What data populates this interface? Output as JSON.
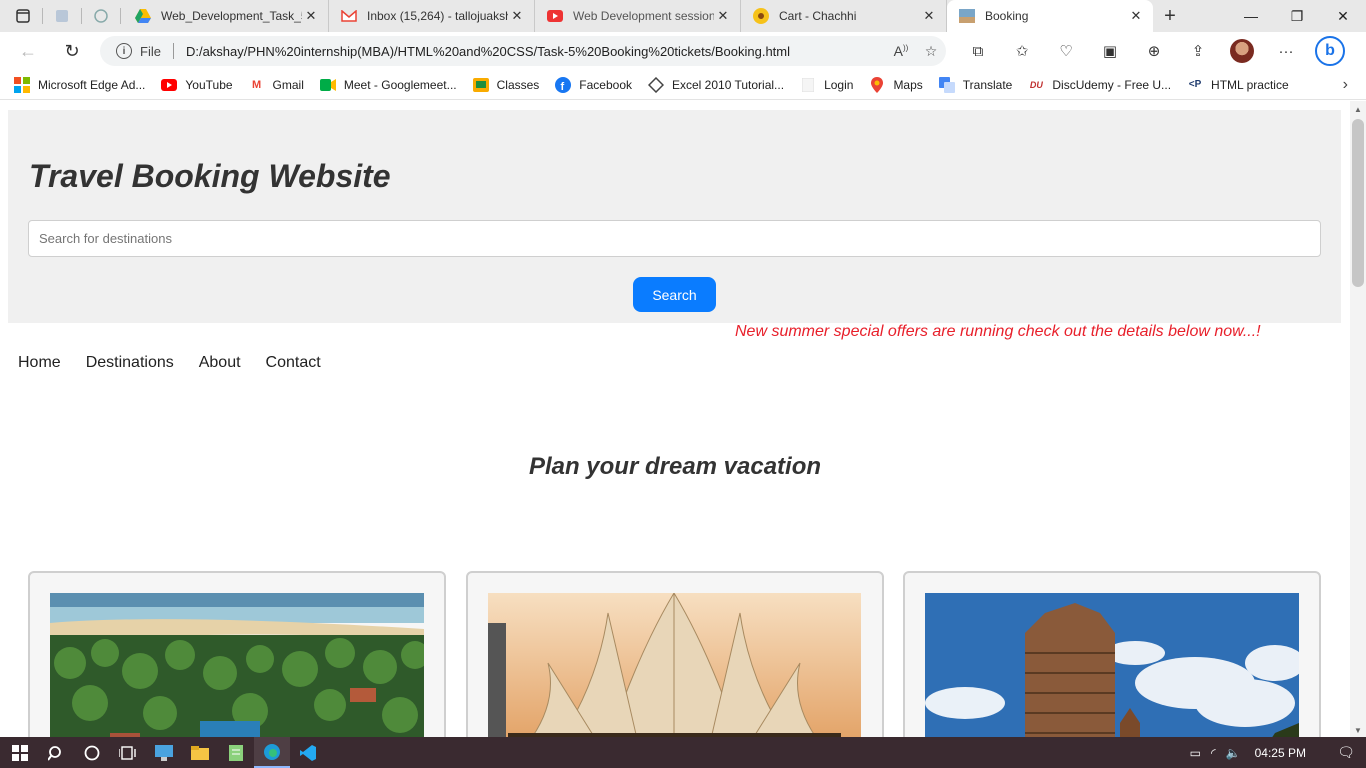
{
  "browser": {
    "tabs": [
      {
        "title": "Web_Development_Task_5",
        "icon": "google-drive-icon",
        "active": false
      },
      {
        "title": "Inbox (15,264) - tallojuaksh",
        "icon": "gmail-icon",
        "active": false
      },
      {
        "title": "Web Development session",
        "icon": "youtube-icon",
        "active": false
      },
      {
        "title": "Cart - Chachhi",
        "icon": "cart-site-icon",
        "active": false
      },
      {
        "title": "Booking",
        "icon": "page-icon",
        "active": true
      }
    ],
    "address": {
      "file_label": "File",
      "url": "D:/akshay/PHN%20internship(MBA)/HTML%20and%20CSS/Task-5%20Booking%20tickets/Booking.html"
    },
    "bookmarks": [
      {
        "label": "Microsoft Edge Ad...",
        "icon": "microsoft-icon"
      },
      {
        "label": "YouTube",
        "icon": "youtube-icon"
      },
      {
        "label": "Gmail",
        "icon": "gmail-icon"
      },
      {
        "label": "Meet - Googlemeet...",
        "icon": "google-meet-icon"
      },
      {
        "label": "Classes",
        "icon": "classroom-icon"
      },
      {
        "label": "Facebook",
        "icon": "facebook-icon"
      },
      {
        "label": "Excel 2010 Tutorial...",
        "icon": "excel-tutorial-icon"
      },
      {
        "label": "Login",
        "icon": "blank-page-icon"
      },
      {
        "label": "Maps",
        "icon": "maps-icon"
      },
      {
        "label": "Translate",
        "icon": "translate-icon"
      },
      {
        "label": "DiscUdemy - Free U...",
        "icon": "discudemy-icon"
      },
      {
        "label": "HTML practice",
        "icon": "code-icon"
      }
    ]
  },
  "page": {
    "title": "Travel Booking Website",
    "search": {
      "placeholder": "Search for destinations",
      "button_label": "Search"
    },
    "offer_text": "New summer special offers are running check out the details below now...!",
    "nav": [
      "Home",
      "Destinations",
      "About",
      "Contact"
    ],
    "heading": "Plan your dream vacation",
    "cards": [
      {
        "image": "beach-resort-image"
      },
      {
        "image": "lotus-temple-image"
      },
      {
        "image": "stone-temple-image"
      }
    ]
  },
  "taskbar": {
    "time": "04:25 PM"
  },
  "colors": {
    "accent_button": "#0a7cff",
    "offer_text": "#e8202b",
    "header_bg": "#f0f0f0"
  }
}
